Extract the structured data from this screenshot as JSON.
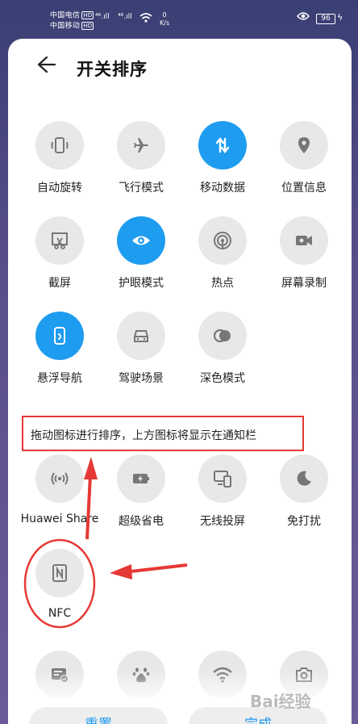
{
  "status_bar": {
    "carrier1": "中国电信",
    "carrier2": "中国移动",
    "hd": "HD",
    "signal1": "⁴⁶.ıll",
    "signal2": "⁴⁶.ıll",
    "wifi_icon": "wifi-icon",
    "net_speed": "0",
    "net_unit": "K/s",
    "battery": "96"
  },
  "header": {
    "title": "开关排序"
  },
  "tiles_top": [
    {
      "label": "自动旋转",
      "icon": "auto-rotate-icon",
      "active": false
    },
    {
      "label": "飞行模式",
      "icon": "airplane-icon",
      "active": false
    },
    {
      "label": "移动数据",
      "icon": "mobile-data-icon",
      "active": true
    },
    {
      "label": "位置信息",
      "icon": "location-icon",
      "active": false
    },
    {
      "label": "截屏",
      "icon": "screenshot-icon",
      "active": false
    },
    {
      "label": "护眼模式",
      "icon": "eye-comfort-icon",
      "active": true
    },
    {
      "label": "热点",
      "icon": "hotspot-icon",
      "active": false
    },
    {
      "label": "屏幕录制",
      "icon": "screen-record-icon",
      "active": false
    },
    {
      "label": "悬浮导航",
      "icon": "floating-nav-icon",
      "active": true
    },
    {
      "label": "驾驶场景",
      "icon": "driving-icon",
      "active": false
    },
    {
      "label": "深色模式",
      "icon": "dark-mode-icon",
      "active": false
    }
  ],
  "hint": "拖动图标进行排序，上方图标将显示在通知栏",
  "tiles_bottom": [
    {
      "label": "Huawei Share",
      "icon": "huawei-share-icon"
    },
    {
      "label": "超级省电",
      "icon": "battery-saver-icon"
    },
    {
      "label": "无线投屏",
      "icon": "wireless-projection-icon"
    },
    {
      "label": "免打扰",
      "icon": "do-not-disturb-icon"
    },
    {
      "label": "NFC",
      "icon": "nfc-icon"
    }
  ],
  "tiles_partial": [
    {
      "icon": "card-check-icon"
    },
    {
      "icon": "baidu-icon"
    },
    {
      "icon": "wifi-icon"
    },
    {
      "icon": "camera-icon"
    }
  ],
  "buttons": {
    "reset": "重置",
    "done": "完成"
  },
  "watermark": "Bai经验",
  "colors": {
    "accent": "#1e9cf0",
    "annotation": "#e53935",
    "tile_bg": "#e8e8e8"
  }
}
